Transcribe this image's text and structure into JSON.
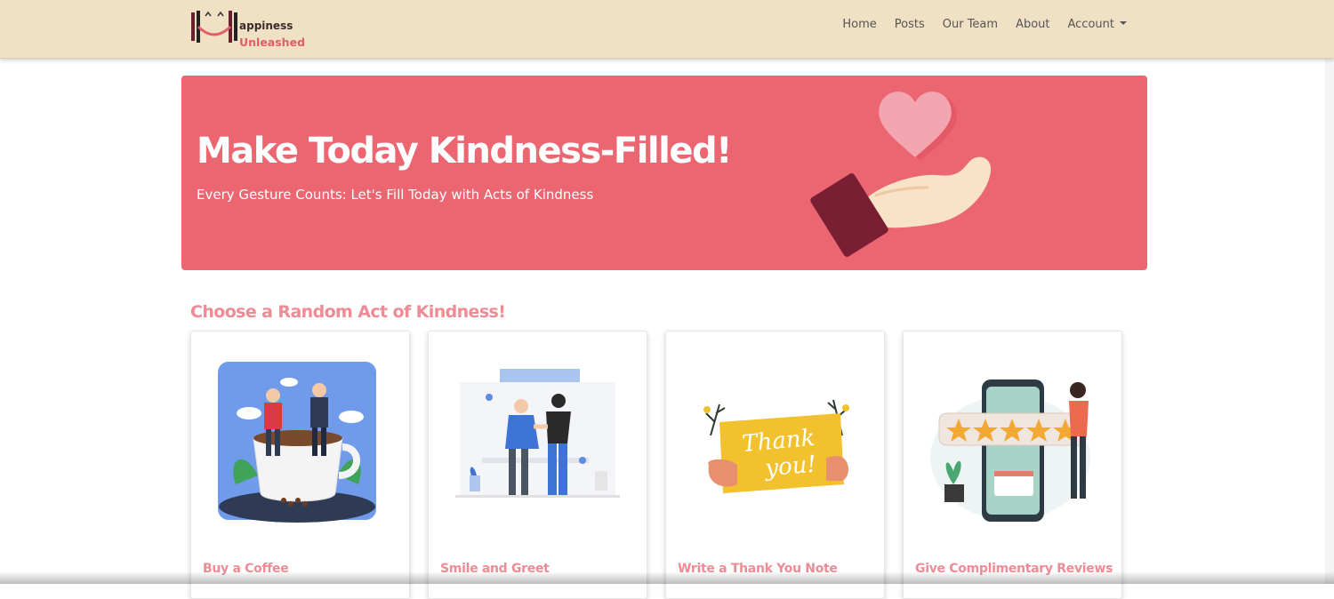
{
  "brand": {
    "line1": "appiness",
    "line2": "Unleashed",
    "logo_icon": "h-smile-logo-icon"
  },
  "nav": {
    "items": [
      {
        "label": "Home"
      },
      {
        "label": "Posts"
      },
      {
        "label": "Our Team"
      },
      {
        "label": "About"
      },
      {
        "label": "Account",
        "dropdown": true
      }
    ]
  },
  "hero": {
    "title": "Make Today Kindness-Filled!",
    "subtitle": "Every Gesture Counts: Let's Fill Today with Acts of Kindness",
    "illustration": "hand-holding-heart-icon",
    "bg_color": "#eb6671"
  },
  "section": {
    "title": "Choose a Random Act of Kindness!"
  },
  "cards": [
    {
      "title": "Buy a Coffee",
      "illustration": "coffee-friends-illustration"
    },
    {
      "title": "Smile and Greet",
      "illustration": "handshake-illustration"
    },
    {
      "title": "Write a Thank You Note",
      "illustration": "thank-you-card-illustration"
    },
    {
      "title": "Give Complimentary Reviews",
      "illustration": "five-star-review-illustration"
    }
  ],
  "colors": {
    "navbar": "#f0e1c5",
    "accent": "#ee8b95",
    "hero": "#eb6671"
  }
}
